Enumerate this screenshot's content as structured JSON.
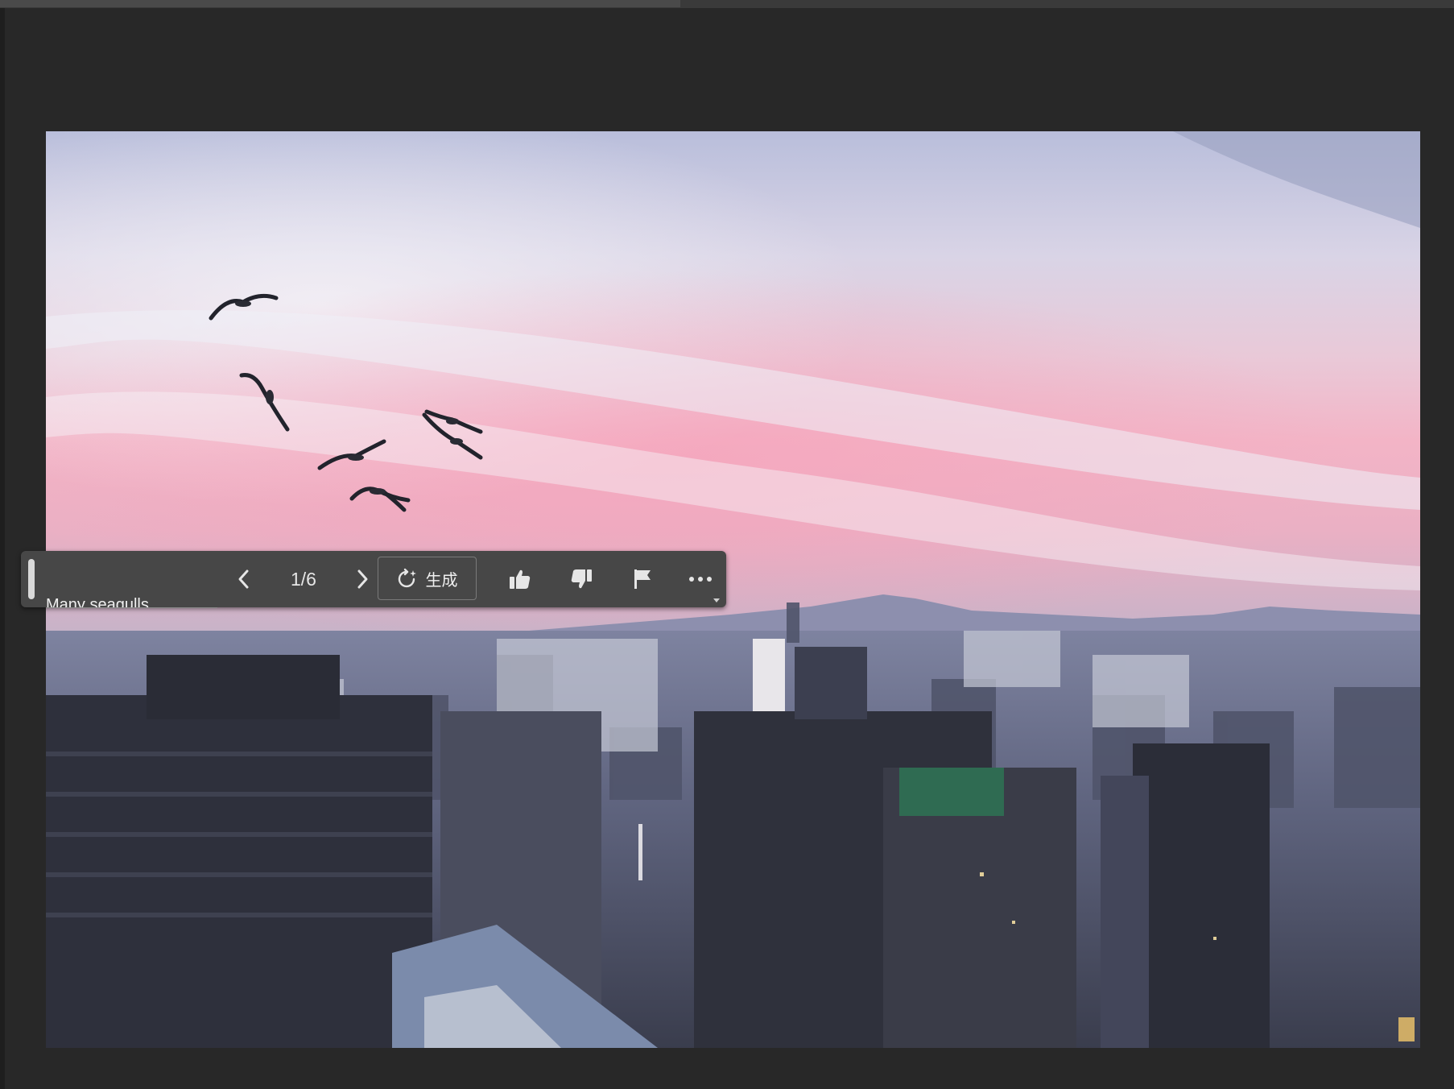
{
  "canvas": {
    "image_subject": "seagulls-over-city-at-dusk"
  },
  "taskbar": {
    "prompt_text": "Many seagulls",
    "counter": "1/6",
    "generate_label": "生成",
    "icons": {
      "prev": "chevron-left-icon",
      "next": "chevron-right-icon",
      "generate": "generate-sparkle-icon",
      "like": "thumbs-up-icon",
      "dislike": "thumbs-down-icon",
      "flag": "flag-icon",
      "more": "more-horizontal-icon"
    }
  },
  "colors": {
    "app_background": "#282828",
    "taskbar_background": "#474747",
    "sky_top": "#c9cce3",
    "sky_pink": "#f2a9bd",
    "city": "#6b7086"
  }
}
